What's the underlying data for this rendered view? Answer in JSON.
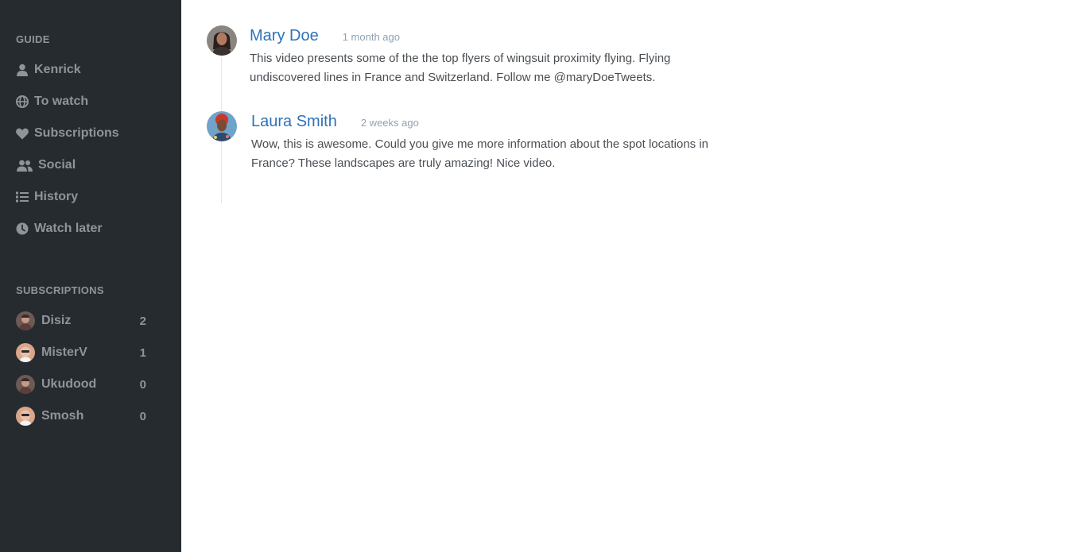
{
  "sidebar": {
    "guide_title": "GUIDE",
    "guide_items": [
      {
        "label": "Kenrick",
        "icon": "user-icon"
      },
      {
        "label": "To watch",
        "icon": "globe-icon"
      },
      {
        "label": "Subscriptions",
        "icon": "heart-icon"
      },
      {
        "label": "Social",
        "icon": "users-icon"
      },
      {
        "label": "History",
        "icon": "list-icon"
      },
      {
        "label": "Watch later",
        "icon": "clock-icon"
      }
    ],
    "subscriptions_title": "SUBSCRIPTIONS",
    "subscriptions": [
      {
        "name": "Disiz",
        "count": "2"
      },
      {
        "name": "MisterV",
        "count": "1"
      },
      {
        "name": "Ukudood",
        "count": "0"
      },
      {
        "name": "Smosh",
        "count": "0"
      }
    ]
  },
  "comments": [
    {
      "author": "Mary Doe",
      "time": "1 month ago",
      "text": "This video presents some of the the top flyers of wingsuit proximity flying. Flying undiscovered lines in France and Switzerland. Follow me @maryDoeTweets."
    },
    {
      "author": "Laura Smith",
      "time": "2 weeks ago",
      "text": "Wow, this is awesome. Could you give me more information about the spot locations in France? These landscapes are truly amazing! Nice video."
    }
  ],
  "colors": {
    "sidebar_bg": "#262b2f",
    "sidebar_text": "#8e9498",
    "author_link": "#2e72b8",
    "timestamp": "#8fa2b4",
    "body_text": "#4a4f54"
  }
}
